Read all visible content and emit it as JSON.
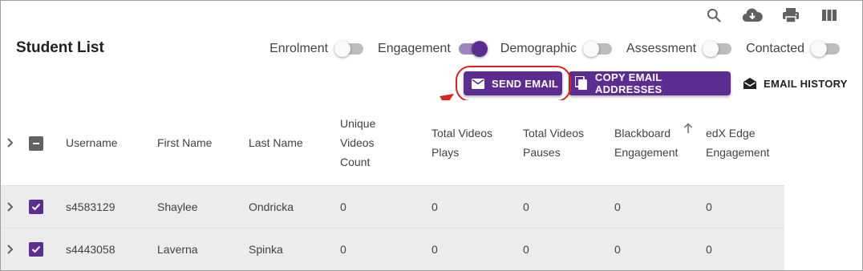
{
  "page": {
    "title": "Student List"
  },
  "top_icons": [
    "search-icon",
    "cloud-download-icon",
    "print-icon",
    "columns-icon"
  ],
  "toggles": [
    {
      "label": "Enrolment",
      "on": false
    },
    {
      "label": "Engagement",
      "on": true
    },
    {
      "label": "Demographic",
      "on": false
    },
    {
      "label": "Assessment",
      "on": false
    },
    {
      "label": "Contacted",
      "on": false
    }
  ],
  "actions": {
    "send_email": "SEND EMAIL",
    "copy_emails": "COPY EMAIL ADDRESSES",
    "email_history": "EMAIL HISTORY"
  },
  "table": {
    "columns": {
      "username": "Username",
      "first_name": "First Name",
      "last_name": "Last Name",
      "unique_videos": "Unique Videos Count",
      "total_plays": "Total Videos Plays",
      "total_pauses": "Total Videos Pauses",
      "blackboard": "Blackboard Engagement",
      "edx": "edX Edge Engagement"
    },
    "rows": [
      {
        "checked": true,
        "username": "s4583129",
        "first_name": "Shaylee",
        "last_name": "Ondricka",
        "unique_videos": "0",
        "total_plays": "0",
        "total_pauses": "0",
        "blackboard": "0",
        "edx": "0"
      },
      {
        "checked": true,
        "username": "s4443058",
        "first_name": "Laverna",
        "last_name": "Spinka",
        "unique_videos": "0",
        "total_plays": "0",
        "total_pauses": "0",
        "blackboard": "0",
        "edx": "0"
      }
    ]
  },
  "colors": {
    "primary": "#5c2d91",
    "highlight": "#e01f1f",
    "row_bg": "#ececec"
  }
}
